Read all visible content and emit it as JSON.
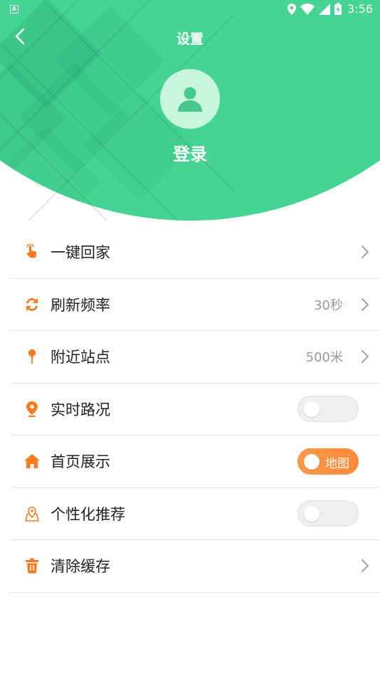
{
  "status_bar": {
    "time": "3:56",
    "left_icon_letter": "A",
    "icons": [
      "location-icon",
      "wifi-icon",
      "signal-icon",
      "battery-icon"
    ]
  },
  "header": {
    "title": "设置",
    "login_label": "登录",
    "background_color": "#45d493",
    "avatar_bg_color": "#c7f5de"
  },
  "settings": {
    "items": [
      {
        "label": "一键回家",
        "icon": "hand-tap-icon",
        "type": "link",
        "value": ""
      },
      {
        "label": "刷新频率",
        "icon": "refresh-icon",
        "type": "link",
        "value": "30秒"
      },
      {
        "label": "附近站点",
        "icon": "pin-icon",
        "type": "link",
        "value": "500米"
      },
      {
        "label": "实时路况",
        "icon": "location-marker-icon",
        "type": "toggle",
        "on": false
      },
      {
        "label": "首页展示",
        "icon": "home-icon",
        "type": "toggle",
        "on": true,
        "toggle_text": "地图"
      },
      {
        "label": "个性化推荐",
        "icon": "map-pin-icon",
        "type": "toggle",
        "on": false
      },
      {
        "label": "清除缓存",
        "icon": "trash-icon",
        "type": "link",
        "value": ""
      }
    ]
  },
  "colors": {
    "accent_orange": "#fd7a1e",
    "toggle_on": "#fe9244",
    "green": "#45d493"
  }
}
